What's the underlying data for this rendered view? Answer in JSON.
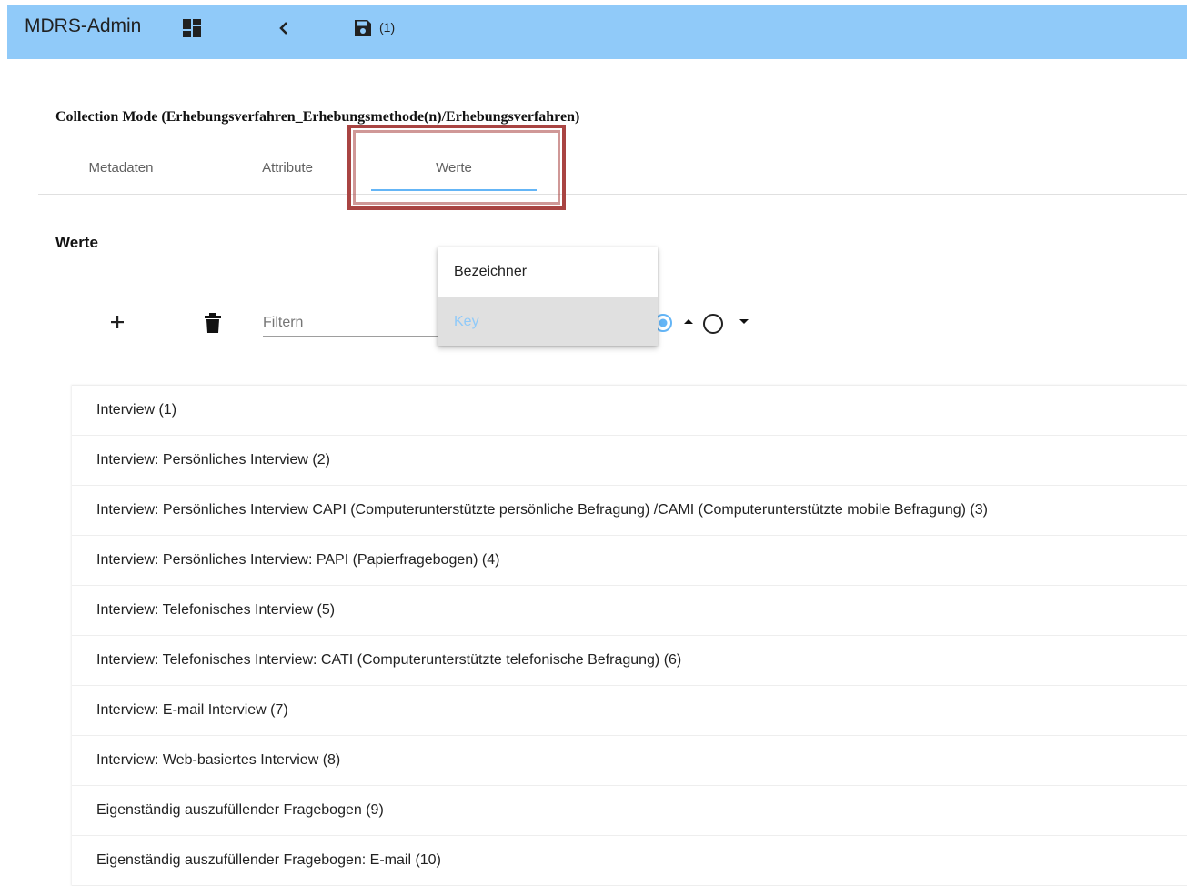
{
  "app": {
    "title": "MDRS-Admin",
    "save_count": "(1)",
    "toolbar_color": "#90caf9",
    "icons": [
      "dashboard-icon",
      "chevron-left-icon",
      "save-icon"
    ]
  },
  "page": {
    "heading": "Collection Mode (Erhebungsverfahren_Erhebungsmethode(n)/Erhebungsverfahren)"
  },
  "tabs": [
    {
      "label": "Metadaten",
      "active": false
    },
    {
      "label": "Attribute",
      "active": false
    },
    {
      "label": "Werte",
      "active": true
    }
  ],
  "section": {
    "title": "Werte"
  },
  "controls": {
    "filter_placeholder": "Filtern",
    "icons": [
      "add-icon",
      "delete-icon",
      "radio-selected-icon",
      "arrow-up-icon",
      "radio-unselected-icon",
      "arrow-down-icon"
    ]
  },
  "dropdown": {
    "items": [
      {
        "label": "Bezeichner",
        "highlighted": false
      },
      {
        "label": "Key",
        "highlighted": true
      }
    ]
  },
  "values": [
    "Interview (1)",
    "Interview: Persönliches Interview (2)",
    "Interview: Persönliches Interview CAPI (Computerunterstützte persönliche Befragung) /CAMI (Computerunterstützte mobile Befragung) (3)",
    "Interview: Persönliches Interview: PAPI (Papierfragebogen) (4)",
    "Interview: Telefonisches Interview (5)",
    "Interview: Telefonisches Interview: CATI (Computerunterstützte telefonische Befragung) (6)",
    "Interview: E-mail Interview (7)",
    "Interview: Web-basiertes Interview (8)",
    "Eigenständig auszufüllender Fragebogen (9)",
    "Eigenständig auszufüllender Fragebogen: E-mail (10)"
  ],
  "colors": {
    "accent": "#64b5f6",
    "highlight_border": "#a94442"
  }
}
